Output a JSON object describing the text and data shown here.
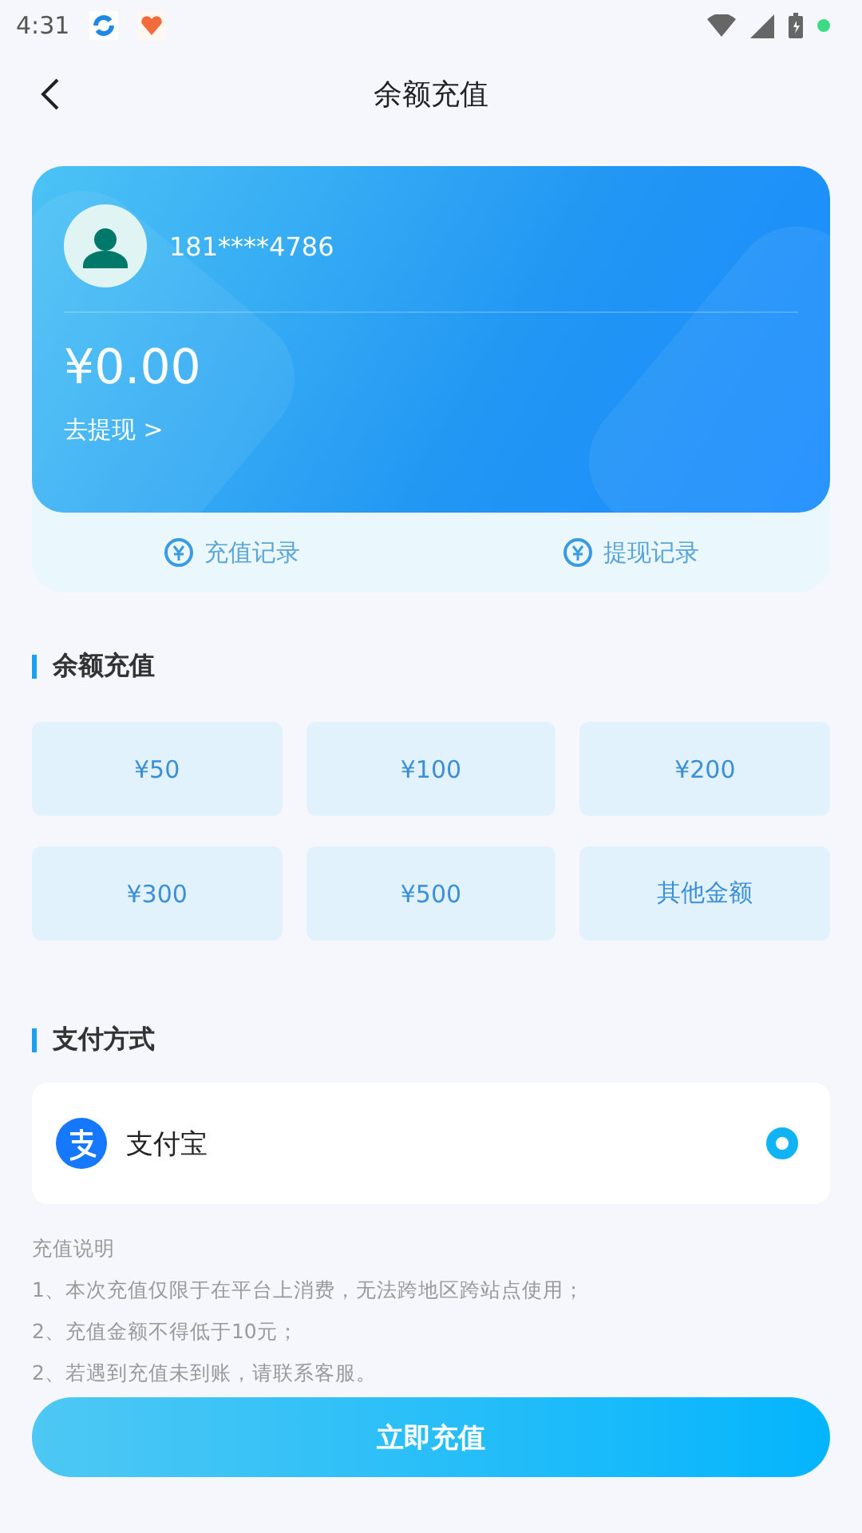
{
  "status_bar": {
    "time": "4:31"
  },
  "header": {
    "title": "余额充值"
  },
  "account": {
    "phone": "181****4786",
    "balance": "¥0.00",
    "withdraw_link": "去提现 >"
  },
  "records": [
    {
      "label": "充值记录"
    },
    {
      "label": "提现记录"
    }
  ],
  "recharge": {
    "title": "余额充值",
    "amounts": [
      {
        "label": "¥50",
        "selected": false
      },
      {
        "label": "¥100",
        "selected": false
      },
      {
        "label": "¥200",
        "selected": false
      },
      {
        "label": "¥300",
        "selected": false
      },
      {
        "label": "¥500",
        "selected": false
      },
      {
        "label": "其他金额",
        "selected": false
      }
    ]
  },
  "payment": {
    "title": "支付方式",
    "methods": [
      {
        "label": "支付宝",
        "selected": true
      }
    ]
  },
  "notes": {
    "title": "充值说明",
    "lines": [
      "1、本次充值仅限于在平台上消费，无法跨地区跨站点使用；",
      "2、充值金额不得低于10元；",
      "2、若遇到充值未到账，请联系客服。"
    ]
  },
  "submit_button": "立即充值"
}
